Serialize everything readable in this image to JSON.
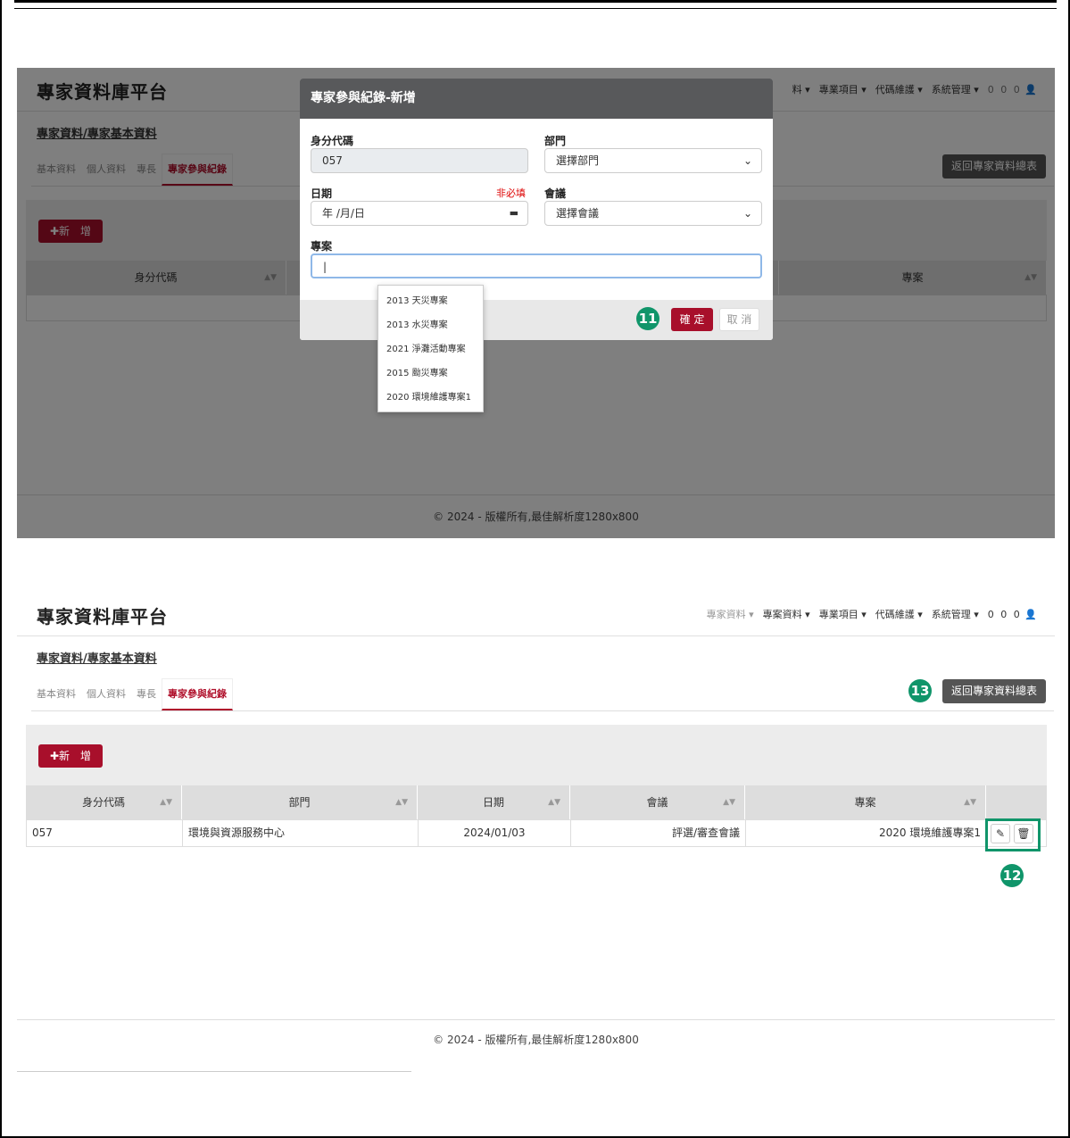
{
  "app": {
    "brand": "專家資料庫平台",
    "footer": "© 2024 - 版權所有,最佳解析度1280x800"
  },
  "nav": {
    "items": [
      "專家資料 ▾",
      "專案資料 ▾",
      "專業項目 ▾",
      "代碼維護 ▾",
      "系統管理 ▾",
      "0 0 0"
    ],
    "partial_item": "料 ▾"
  },
  "page": {
    "breadcrumb": "專家資料/專家基本資料",
    "tabs": [
      "基本資料",
      "個人資料",
      "專長",
      "專家參與紀錄"
    ],
    "back_button": "返回專家資料總表",
    "add_button": "新　增"
  },
  "table": {
    "columns": [
      "身分代碼",
      "部門",
      "日期",
      "會議",
      "專案"
    ],
    "rows": [
      {
        "id": "057",
        "dept": "環境與資源服務中心",
        "date": "2024/01/03",
        "meeting": "評選/審查會議",
        "project": "2020 環境維護專案1"
      }
    ]
  },
  "modal": {
    "title": "專家參與紀錄-新增",
    "id_label": "身分代碼",
    "id_value": "057",
    "dept_label": "部門",
    "dept_placeholder": "選擇部門",
    "date_label": "日期",
    "date_optional": "非必填",
    "date_placeholder": "年 /月/日",
    "meeting_label": "會議",
    "meeting_placeholder": "選擇會議",
    "project_label": "專案",
    "confirm": "確 定",
    "cancel": "取 消",
    "suggestions": [
      "2013 天災專案",
      "2013 水災專案",
      "2021 淨灘活動專案",
      "2015 颱災專案",
      "2020 環境維護專案1"
    ]
  },
  "annotations": {
    "step11": "11",
    "step12": "12",
    "step13": "13"
  },
  "colors": {
    "accent": "#a80f2b",
    "annotation": "#10956a",
    "dark_button": "#555555"
  }
}
